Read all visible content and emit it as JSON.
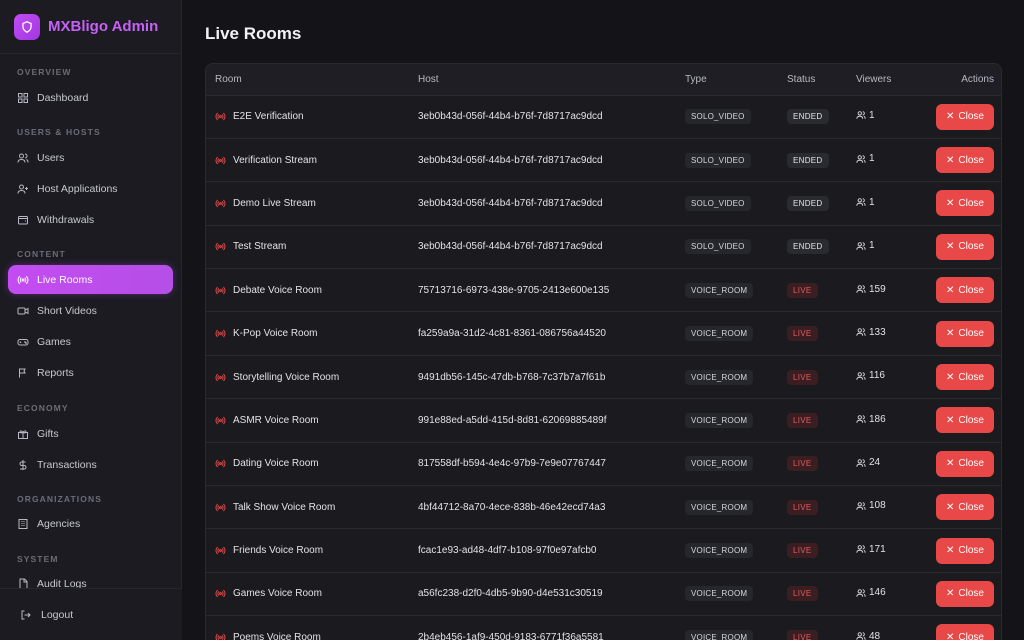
{
  "app": {
    "title": "MXBligo Admin",
    "accent": "#c34cf2",
    "danger": "#e84848"
  },
  "sidebar": {
    "sections": [
      {
        "label": "OVERVIEW"
      },
      {
        "label": "USERS & HOSTS"
      },
      {
        "label": "CONTENT"
      },
      {
        "label": "ECONOMY"
      },
      {
        "label": "ORGANIZATIONS"
      },
      {
        "label": "SYSTEM"
      }
    ],
    "items": [
      {
        "label": "Dashboard",
        "icon": "dashboard-icon"
      },
      {
        "label": "Users",
        "icon": "users-icon"
      },
      {
        "label": "Host Applications",
        "icon": "user-plus-icon"
      },
      {
        "label": "Withdrawals",
        "icon": "wallet-icon"
      },
      {
        "label": "Live Rooms",
        "icon": "broadcast-icon",
        "active": true
      },
      {
        "label": "Short Videos",
        "icon": "video-icon"
      },
      {
        "label": "Games",
        "icon": "gamepad-icon"
      },
      {
        "label": "Reports",
        "icon": "flag-icon"
      },
      {
        "label": "Gifts",
        "icon": "gift-icon"
      },
      {
        "label": "Transactions",
        "icon": "dollar-icon"
      },
      {
        "label": "Agencies",
        "icon": "building-icon"
      },
      {
        "label": "Audit Logs",
        "icon": "file-icon"
      }
    ],
    "logout": "Logout"
  },
  "main": {
    "title": "Live Rooms",
    "columns": [
      "Room",
      "Host",
      "Type",
      "Status",
      "Viewers",
      "Actions"
    ],
    "close_label": "Close",
    "rows": [
      {
        "room": "E2E Verification",
        "host": "3eb0b43d-056f-44b4-b76f-7d8717ac9dcd",
        "type": "SOLO_VIDEO",
        "status": "ENDED",
        "viewers": "1"
      },
      {
        "room": "Verification Stream",
        "host": "3eb0b43d-056f-44b4-b76f-7d8717ac9dcd",
        "type": "SOLO_VIDEO",
        "status": "ENDED",
        "viewers": "1"
      },
      {
        "room": "Demo Live Stream",
        "host": "3eb0b43d-056f-44b4-b76f-7d8717ac9dcd",
        "type": "SOLO_VIDEO",
        "status": "ENDED",
        "viewers": "1"
      },
      {
        "room": "Test Stream",
        "host": "3eb0b43d-056f-44b4-b76f-7d8717ac9dcd",
        "type": "SOLO_VIDEO",
        "status": "ENDED",
        "viewers": "1"
      },
      {
        "room": "Debate Voice Room",
        "host": "75713716-6973-438e-9705-2413e600e135",
        "type": "VOICE_ROOM",
        "status": "LIVE",
        "viewers": "159"
      },
      {
        "room": "K-Pop Voice Room",
        "host": "fa259a9a-31d2-4c81-8361-086756a44520",
        "type": "VOICE_ROOM",
        "status": "LIVE",
        "viewers": "133"
      },
      {
        "room": "Storytelling Voice Room",
        "host": "9491db56-145c-47db-b768-7c37b7a7f61b",
        "type": "VOICE_ROOM",
        "status": "LIVE",
        "viewers": "116"
      },
      {
        "room": "ASMR Voice Room",
        "host": "991e88ed-a5dd-415d-8d81-62069885489f",
        "type": "VOICE_ROOM",
        "status": "LIVE",
        "viewers": "186"
      },
      {
        "room": "Dating Voice Room",
        "host": "817558df-b594-4e4c-97b9-7e9e07767447",
        "type": "VOICE_ROOM",
        "status": "LIVE",
        "viewers": "24"
      },
      {
        "room": "Talk Show Voice Room",
        "host": "4bf44712-8a70-4ece-838b-46e42ecd74a3",
        "type": "VOICE_ROOM",
        "status": "LIVE",
        "viewers": "108"
      },
      {
        "room": "Friends Voice Room",
        "host": "fcac1e93-ad48-4df7-b108-97f0e97afcb0",
        "type": "VOICE_ROOM",
        "status": "LIVE",
        "viewers": "171"
      },
      {
        "room": "Games Voice Room",
        "host": "a56fc238-d2f0-4db5-9b90-d4e531c30519",
        "type": "VOICE_ROOM",
        "status": "LIVE",
        "viewers": "146"
      },
      {
        "room": "Poems Voice Room",
        "host": "2b4eb456-1af9-450d-9183-6771f36a5581",
        "type": "VOICE_ROOM",
        "status": "LIVE",
        "viewers": "48"
      }
    ]
  }
}
